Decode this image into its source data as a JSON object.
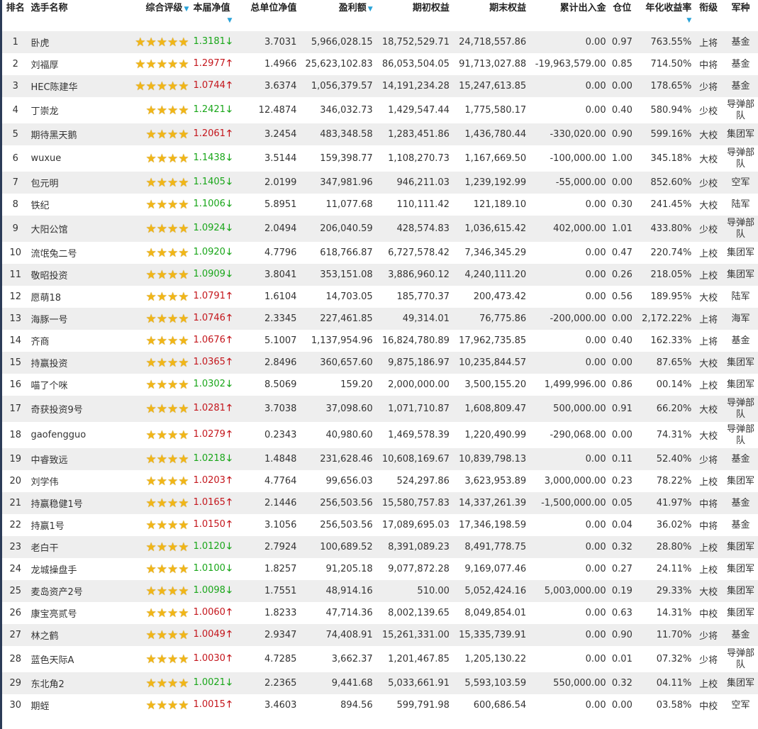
{
  "headers": {
    "rank": "排名",
    "name": "选手名称",
    "rating": "综合评级",
    "week_nav": "本届净值",
    "total_nav": "总单位净值",
    "profit": "盈利额",
    "start_equity": "期初权益",
    "end_equity": "期末权益",
    "cum_flow": "累计出入金",
    "position": "仓位",
    "annual": "年化收益率",
    "rank_title": "衔级",
    "army": "军种"
  },
  "colors": {
    "up": "#c4161c",
    "down": "#19a619",
    "star": "#f1b617",
    "sort_arrow": "#2aa3d8"
  },
  "rows": [
    {
      "rank": "1",
      "name": "卧虎",
      "stars": 5,
      "nav": "1.3181",
      "dir": "down",
      "total": "3.7031",
      "profit": "5,966,028.15",
      "start": "18,752,529.71",
      "end": "24,718,557.86",
      "flow": "0.00",
      "pos": "0.97",
      "annual": "763.55%",
      "title": "上将",
      "army": "基金"
    },
    {
      "rank": "2",
      "name": "刘福厚",
      "stars": 5,
      "nav": "1.2977",
      "dir": "up",
      "total": "1.4966",
      "profit": "25,623,102.83",
      "start": "86,053,504.05",
      "end": "91,713,027.88",
      "flow": "-19,963,579.00",
      "pos": "0.85",
      "annual": "714.50%",
      "title": "中将",
      "army": "基金"
    },
    {
      "rank": "3",
      "name": "HEC陈建华",
      "stars": 5,
      "nav": "1.0744",
      "dir": "up",
      "total": "3.6374",
      "profit": "1,056,379.57",
      "start": "14,191,234.28",
      "end": "15,247,613.85",
      "flow": "0.00",
      "pos": "0.00",
      "annual": "178.65%",
      "title": "少将",
      "army": "基金"
    },
    {
      "rank": "4",
      "name": "丁崇龙",
      "stars": 4,
      "nav": "1.2421",
      "dir": "down",
      "total": "12.4874",
      "profit": "346,032.73",
      "start": "1,429,547.44",
      "end": "1,775,580.17",
      "flow": "0.00",
      "pos": "0.40",
      "annual": "580.94%",
      "title": "少校",
      "army": "导弹部队"
    },
    {
      "rank": "5",
      "name": "期待黑天鹅",
      "stars": 4,
      "nav": "1.2061",
      "dir": "up",
      "total": "3.2454",
      "profit": "483,348.58",
      "start": "1,283,451.86",
      "end": "1,436,780.44",
      "flow": "-330,020.00",
      "pos": "0.90",
      "annual": "599.16%",
      "title": "大校",
      "army": "集团军"
    },
    {
      "rank": "6",
      "name": "wuxue",
      "stars": 4,
      "nav": "1.1438",
      "dir": "down",
      "total": "3.5144",
      "profit": "159,398.77",
      "start": "1,108,270.73",
      "end": "1,167,669.50",
      "flow": "-100,000.00",
      "pos": "1.00",
      "annual": "345.18%",
      "title": "大校",
      "army": "导弹部队"
    },
    {
      "rank": "7",
      "name": "包元明",
      "stars": 4,
      "nav": "1.1405",
      "dir": "down",
      "total": "2.0199",
      "profit": "347,981.96",
      "start": "946,211.03",
      "end": "1,239,192.99",
      "flow": "-55,000.00",
      "pos": "0.00",
      "annual": "852.60%",
      "title": "少校",
      "army": "空军"
    },
    {
      "rank": "8",
      "name": "铁纪",
      "stars": 4,
      "nav": "1.1006",
      "dir": "down",
      "total": "5.8951",
      "profit": "11,077.68",
      "start": "110,111.42",
      "end": "121,189.10",
      "flow": "0.00",
      "pos": "0.30",
      "annual": "241.45%",
      "title": "大校",
      "army": "陆军"
    },
    {
      "rank": "9",
      "name": "大阳公馆",
      "stars": 4,
      "nav": "1.0924",
      "dir": "down",
      "total": "2.0494",
      "profit": "206,040.59",
      "start": "428,574.83",
      "end": "1,036,615.42",
      "flow": "402,000.00",
      "pos": "1.01",
      "annual": "433.80%",
      "title": "少校",
      "army": "导弹部队"
    },
    {
      "rank": "10",
      "name": "流氓兔二号",
      "stars": 4,
      "nav": "1.0920",
      "dir": "down",
      "total": "4.7796",
      "profit": "618,766.87",
      "start": "6,727,578.42",
      "end": "7,346,345.29",
      "flow": "0.00",
      "pos": "0.47",
      "annual": "220.74%",
      "title": "上校",
      "army": "集团军"
    },
    {
      "rank": "11",
      "name": "敬昭投资",
      "stars": 4,
      "nav": "1.0909",
      "dir": "down",
      "total": "3.8041",
      "profit": "353,151.08",
      "start": "3,886,960.12",
      "end": "4,240,111.20",
      "flow": "0.00",
      "pos": "0.26",
      "annual": "218.05%",
      "title": "上校",
      "army": "集团军"
    },
    {
      "rank": "12",
      "name": "愿萌18",
      "stars": 4,
      "nav": "1.0791",
      "dir": "up",
      "total": "1.6104",
      "profit": "14,703.05",
      "start": "185,770.37",
      "end": "200,473.42",
      "flow": "0.00",
      "pos": "0.56",
      "annual": "189.95%",
      "title": "大校",
      "army": "陆军"
    },
    {
      "rank": "13",
      "name": "海豚一号",
      "stars": 4,
      "nav": "1.0746",
      "dir": "up",
      "total": "2.3345",
      "profit": "227,461.85",
      "start": "49,314.01",
      "end": "76,775.86",
      "flow": "-200,000.00",
      "pos": "0.00",
      "annual": "2,172.22%",
      "title": "上将",
      "army": "海军"
    },
    {
      "rank": "14",
      "name": "齐商",
      "stars": 4,
      "nav": "1.0676",
      "dir": "up",
      "total": "5.1007",
      "profit": "1,137,954.96",
      "start": "16,824,780.89",
      "end": "17,962,735.85",
      "flow": "0.00",
      "pos": "0.40",
      "annual": "162.33%",
      "title": "上将",
      "army": "基金"
    },
    {
      "rank": "15",
      "name": "持赢投资",
      "stars": 4,
      "nav": "1.0365",
      "dir": "up",
      "total": "2.8496",
      "profit": "360,657.60",
      "start": "9,875,186.97",
      "end": "10,235,844.57",
      "flow": "0.00",
      "pos": "0.00",
      "annual": "87.65%",
      "title": "大校",
      "army": "集团军"
    },
    {
      "rank": "16",
      "name": "喵了个咪",
      "stars": 4,
      "nav": "1.0302",
      "dir": "down",
      "total": "8.5069",
      "profit": "159.20",
      "start": "2,000,000.00",
      "end": "3,500,155.20",
      "flow": "1,499,996.00",
      "pos": "0.86",
      "annual": "00.14%",
      "title": "上校",
      "army": "集团军"
    },
    {
      "rank": "17",
      "name": "奇获投资9号",
      "stars": 4,
      "nav": "1.0281",
      "dir": "up",
      "total": "3.7038",
      "profit": "37,098.60",
      "start": "1,071,710.87",
      "end": "1,608,809.47",
      "flow": "500,000.00",
      "pos": "0.91",
      "annual": "66.20%",
      "title": "大校",
      "army": "导弹部队"
    },
    {
      "rank": "18",
      "name": "gaofengguo",
      "stars": 4,
      "nav": "1.0279",
      "dir": "up",
      "total": "0.2343",
      "profit": "40,980.60",
      "start": "1,469,578.39",
      "end": "1,220,490.99",
      "flow": "-290,068.00",
      "pos": "0.00",
      "annual": "74.31%",
      "title": "大校",
      "army": "导弹部队"
    },
    {
      "rank": "19",
      "name": "中睿致远",
      "stars": 4,
      "nav": "1.0218",
      "dir": "down",
      "total": "1.4848",
      "profit": "231,628.46",
      "start": "10,608,169.67",
      "end": "10,839,798.13",
      "flow": "0.00",
      "pos": "0.11",
      "annual": "52.40%",
      "title": "少将",
      "army": "基金"
    },
    {
      "rank": "20",
      "name": "刘学伟",
      "stars": 4,
      "nav": "1.0203",
      "dir": "up",
      "total": "4.7764",
      "profit": "99,656.03",
      "start": "524,297.86",
      "end": "3,623,953.89",
      "flow": "3,000,000.00",
      "pos": "0.23",
      "annual": "78.22%",
      "title": "上校",
      "army": "集团军"
    },
    {
      "rank": "21",
      "name": "持赢稳健1号",
      "stars": 4,
      "nav": "1.0165",
      "dir": "up",
      "total": "2.1446",
      "profit": "256,503.56",
      "start": "15,580,757.83",
      "end": "14,337,261.39",
      "flow": "-1,500,000.00",
      "pos": "0.05",
      "annual": "41.97%",
      "title": "中将",
      "army": "基金"
    },
    {
      "rank": "22",
      "name": "持赢1号",
      "stars": 4,
      "nav": "1.0150",
      "dir": "up",
      "total": "3.1056",
      "profit": "256,503.56",
      "start": "17,089,695.03",
      "end": "17,346,198.59",
      "flow": "0.00",
      "pos": "0.04",
      "annual": "36.02%",
      "title": "中将",
      "army": "基金"
    },
    {
      "rank": "23",
      "name": "老白干",
      "stars": 4,
      "nav": "1.0120",
      "dir": "down",
      "total": "2.7924",
      "profit": "100,689.52",
      "start": "8,391,089.23",
      "end": "8,491,778.75",
      "flow": "0.00",
      "pos": "0.32",
      "annual": "28.80%",
      "title": "上校",
      "army": "集团军"
    },
    {
      "rank": "24",
      "name": "龙城操盘手",
      "stars": 4,
      "nav": "1.0100",
      "dir": "down",
      "total": "1.8257",
      "profit": "91,205.18",
      "start": "9,077,872.28",
      "end": "9,169,077.46",
      "flow": "0.00",
      "pos": "0.27",
      "annual": "24.11%",
      "title": "上校",
      "army": "集团军"
    },
    {
      "rank": "25",
      "name": "麦岛资产2号",
      "stars": 4,
      "nav": "1.0098",
      "dir": "down",
      "total": "1.7551",
      "profit": "48,914.16",
      "start": "510.00",
      "end": "5,052,424.16",
      "flow": "5,003,000.00",
      "pos": "0.19",
      "annual": "29.33%",
      "title": "大校",
      "army": "集团军"
    },
    {
      "rank": "26",
      "name": "康宝亮贰号",
      "stars": 4,
      "nav": "1.0060",
      "dir": "up",
      "total": "1.8233",
      "profit": "47,714.36",
      "start": "8,002,139.65",
      "end": "8,049,854.01",
      "flow": "0.00",
      "pos": "0.63",
      "annual": "14.31%",
      "title": "中校",
      "army": "集团军"
    },
    {
      "rank": "27",
      "name": "林之鹤",
      "stars": 4,
      "nav": "1.0049",
      "dir": "up",
      "total": "2.9347",
      "profit": "74,408.91",
      "start": "15,261,331.00",
      "end": "15,335,739.91",
      "flow": "0.00",
      "pos": "0.90",
      "annual": "11.70%",
      "title": "少将",
      "army": "基金"
    },
    {
      "rank": "28",
      "name": "蓝色天际A",
      "stars": 4,
      "nav": "1.0030",
      "dir": "up",
      "total": "4.7285",
      "profit": "3,662.37",
      "start": "1,201,467.85",
      "end": "1,205,130.22",
      "flow": "0.00",
      "pos": "0.01",
      "annual": "07.32%",
      "title": "少将",
      "army": "导弹部队"
    },
    {
      "rank": "29",
      "name": "东北角2",
      "stars": 4,
      "nav": "1.0021",
      "dir": "down",
      "total": "2.2365",
      "profit": "9,441.68",
      "start": "5,033,661.91",
      "end": "5,593,103.59",
      "flow": "550,000.00",
      "pos": "0.32",
      "annual": "04.11%",
      "title": "上校",
      "army": "集团军"
    },
    {
      "rank": "30",
      "name": "期蛭",
      "stars": 4,
      "nav": "1.0015",
      "dir": "up",
      "total": "3.4603",
      "profit": "894.56",
      "start": "599,791.98",
      "end": "600,686.54",
      "flow": "0.00",
      "pos": "0.00",
      "annual": "03.58%",
      "title": "中校",
      "army": "空军"
    }
  ]
}
